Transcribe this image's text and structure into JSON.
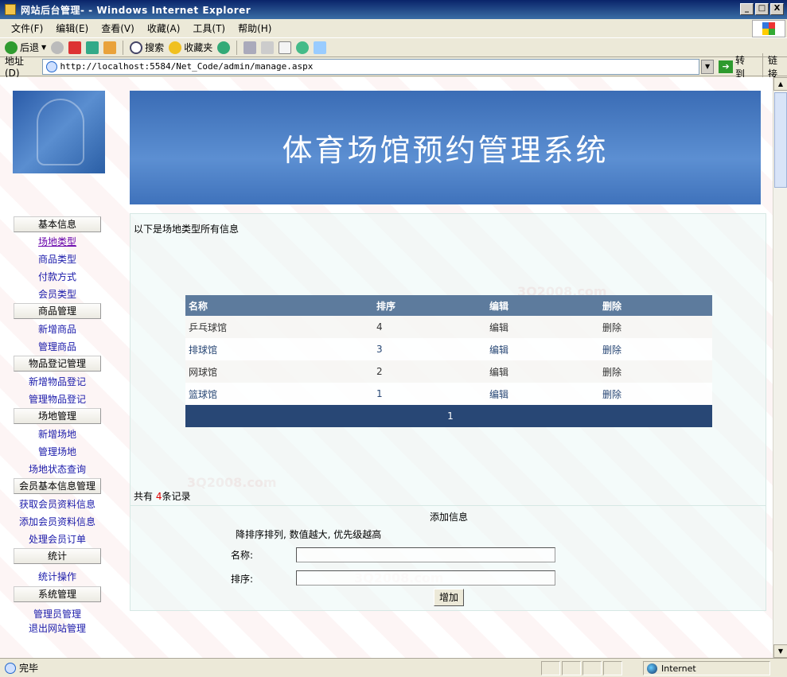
{
  "window": {
    "title": "网站后台管理- - Windows Internet Explorer",
    "minimize": "_",
    "maximize": "□",
    "close": "X"
  },
  "menu": [
    "文件(F)",
    "编辑(E)",
    "查看(V)",
    "收藏(A)",
    "工具(T)",
    "帮助(H)"
  ],
  "toolbar": {
    "back": "后退",
    "search": "搜索",
    "favorites": "收藏夹"
  },
  "address": {
    "label": "地址(D)",
    "url": "http://localhost:5584/Net_Code/admin/manage.aspx",
    "go": "转到",
    "links": "链接"
  },
  "banner": {
    "title": "体育场馆预约管理系统"
  },
  "sidebar": {
    "groups": [
      {
        "title": "基本信息",
        "items": [
          "场地类型",
          "商品类型",
          "付款方式",
          "会员类型"
        ]
      },
      {
        "title": "商品管理",
        "items": [
          "新增商品",
          "管理商品"
        ]
      },
      {
        "title": "物品登记管理",
        "items": [
          "新增物品登记",
          "管理物品登记"
        ]
      },
      {
        "title": "场地管理",
        "items": [
          "新增场地",
          "管理场地",
          "场地状态查询"
        ]
      },
      {
        "title": "会员基本信息管理",
        "items": [
          "获取会员资料信息",
          "添加会员资料信息",
          "处理会员订单"
        ]
      },
      {
        "title": "统计",
        "items": [
          "统计操作"
        ]
      },
      {
        "title": "系统管理",
        "items": [
          "管理员管理",
          "退出网站管理"
        ]
      }
    ]
  },
  "main": {
    "caption": "以下是场地类型所有信息",
    "table": {
      "headers": [
        "名称",
        "排序",
        "编辑",
        "删除"
      ],
      "rows": [
        [
          "乒乓球馆",
          "4",
          "编辑",
          "删除"
        ],
        [
          "排球馆",
          "3",
          "编辑",
          "删除"
        ],
        [
          "网球馆",
          "2",
          "编辑",
          "删除"
        ],
        [
          "篮球馆",
          "1",
          "编辑",
          "删除"
        ]
      ],
      "pager": "1"
    },
    "record": {
      "prefix": "共有",
      "count": "4",
      "suffix": "条记录"
    },
    "add": {
      "title": "添加信息",
      "note": "降排序排列, 数值越大, 优先级越高",
      "name_label": "名称:",
      "order_label": "排序:",
      "button": "增加"
    }
  },
  "status": {
    "text": "完毕",
    "zone": "Internet"
  }
}
